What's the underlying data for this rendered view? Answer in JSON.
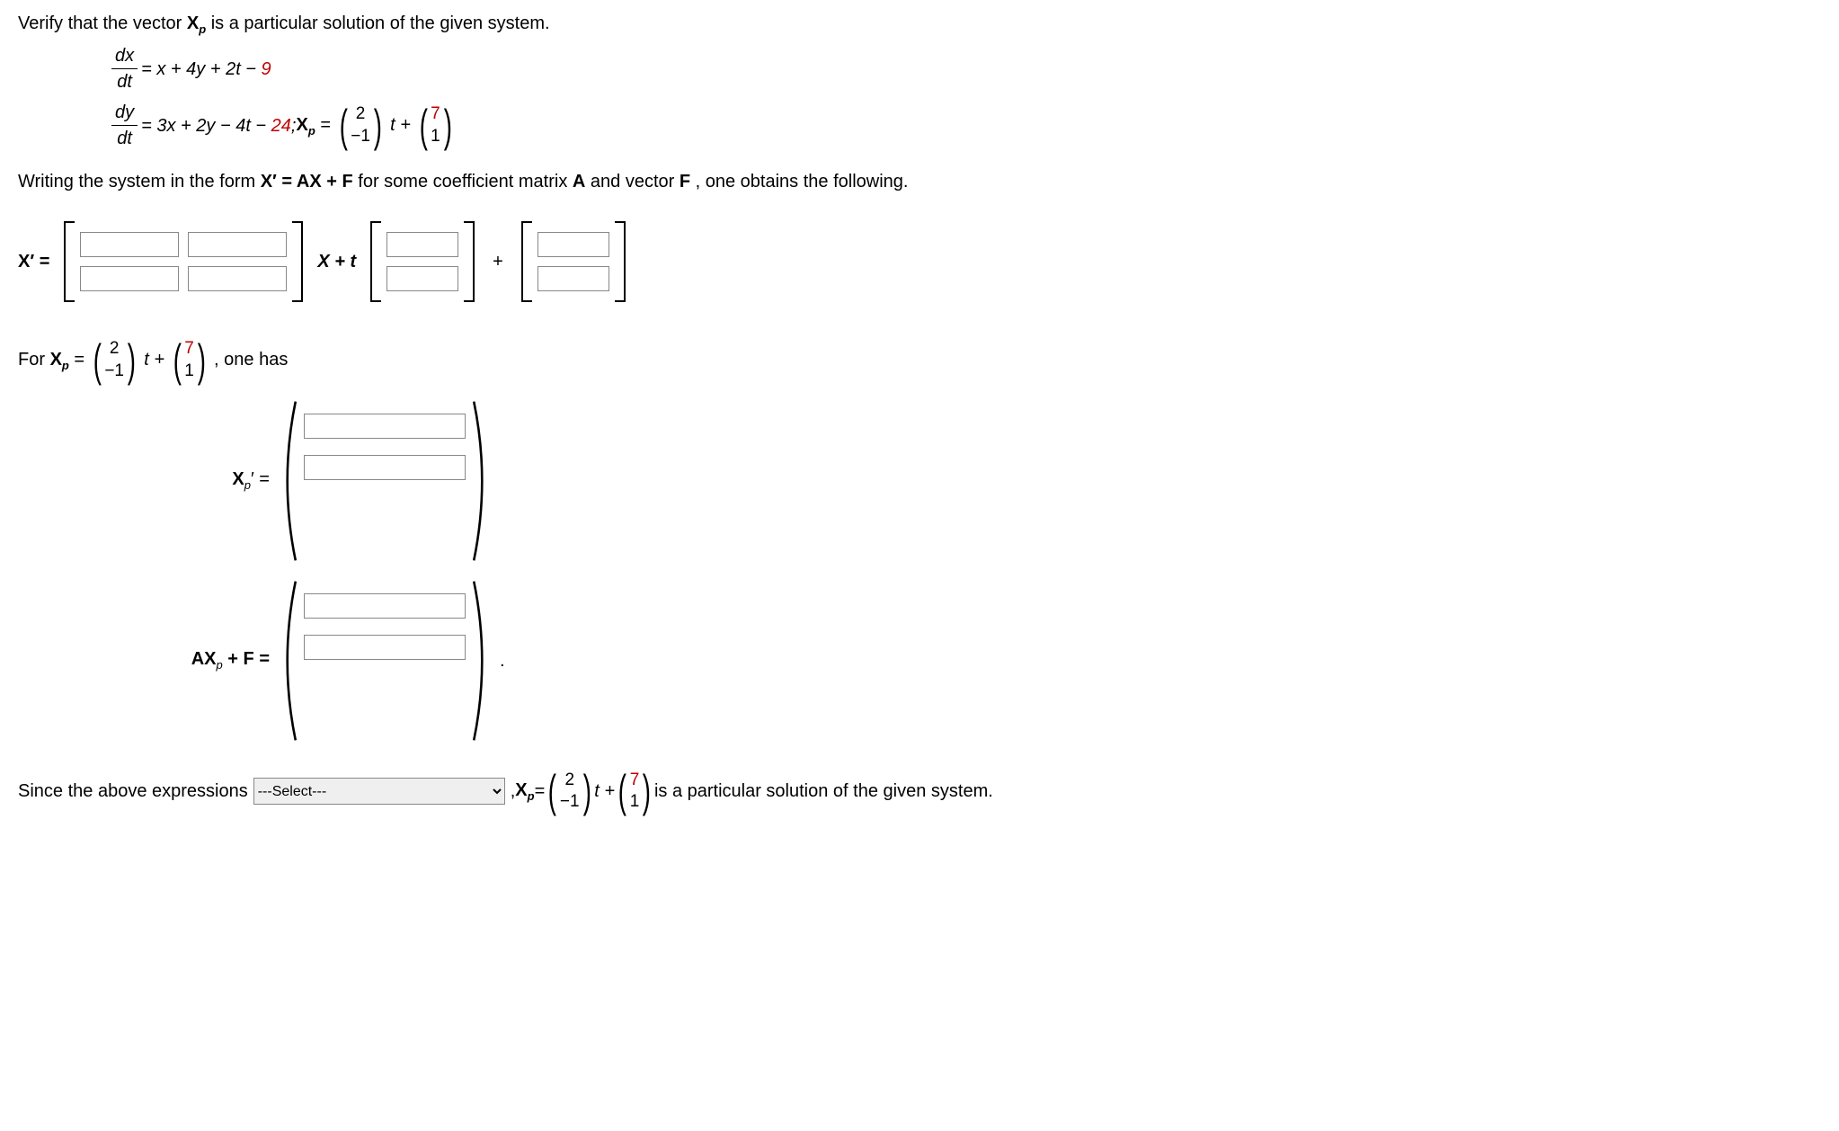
{
  "intro": "Verify that the vector ",
  "intro2": " is a particular solution of the given system.",
  "xp_label_bold": "X",
  "xp_label_sub": "p",
  "eq1": {
    "num": "dx",
    "den": "dt",
    "rhs_a": " = x + 4y + 2t − ",
    "rhs_red": "9"
  },
  "eq2": {
    "num": "dy",
    "den": "dt",
    "rhs_a": " = 3x + 2y − 4t − ",
    "rhs_red": "24",
    "after": ";  ",
    "xp_eq": " = ",
    "v1_top": "2",
    "v1_bot": "−1",
    "mid": "t + ",
    "v2_top": "7",
    "v2_bot": "1"
  },
  "sentence2_a": "Writing the system in the form  ",
  "sentence2_eq": "X′ = AX + F",
  "sentence2_b": "  for some coefficient matrix ",
  "sentence2_A": "A",
  "sentence2_c": " and vector ",
  "sentence2_F": "F",
  "sentence2_d": ", one obtains the following.",
  "row_form": {
    "lhs": "X′ =",
    "mid1": "X + t",
    "plus": "+"
  },
  "for_line_a": "For  ",
  "for_line_eq": " = ",
  "for_v1_top": "2",
  "for_v1_bot": "−1",
  "for_mid": "t + ",
  "for_v2_top": "7",
  "for_v2_bot": "1",
  "for_after": ",   one has",
  "row_xp_prime_lbl_bold": "X",
  "row_xp_prime_lbl_rest": "′  =",
  "row_axpf_lbl_a": "AX",
  "row_axpf_lbl_b": " + F  =",
  "row_axpf_dot": ".",
  "final_a": "Since the above expressions ",
  "select_placeholder": "---Select---",
  "final_b": " ,  ",
  "final_eq": " = ",
  "final_v1_top": "2",
  "final_v1_bot": "−1",
  "final_mid": "t + ",
  "final_v2_top": "7",
  "final_v2_bot": "1",
  "final_c": " is a particular solution of the given system."
}
